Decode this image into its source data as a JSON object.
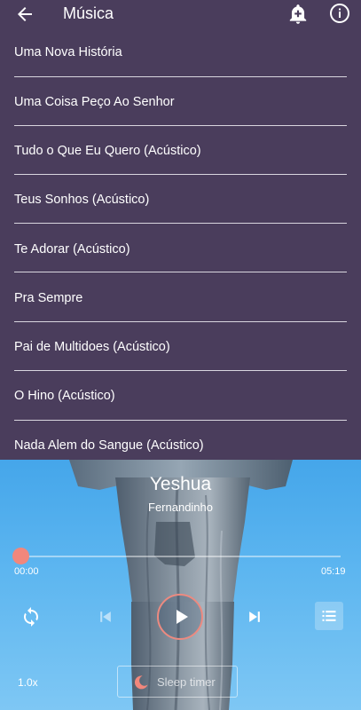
{
  "appbar": {
    "title": "Música",
    "back_icon": "arrow-left-icon",
    "bell_icon": "bell-plus-icon",
    "info_icon": "info-icon"
  },
  "songs": [
    "Uma Nova História",
    "Uma Coisa Peço Ao Senhor",
    "Tudo o Que Eu Quero (Acústico)",
    "Teus Sonhos (Acústico)",
    "Te Adorar (Acústico)",
    "Pra Sempre",
    "Pai de Multidoes (Acústico)",
    "O Hino (Acústico)",
    "Nada Alem do Sangue (Acústico)"
  ],
  "player": {
    "title": "Yeshua",
    "artist": "Fernandinho",
    "current_time": "00:00",
    "total_time": "05:19",
    "progress": 0,
    "speed": "1.0x",
    "sleep_label": "Sleep timer",
    "accent_color": "#f1877c"
  }
}
